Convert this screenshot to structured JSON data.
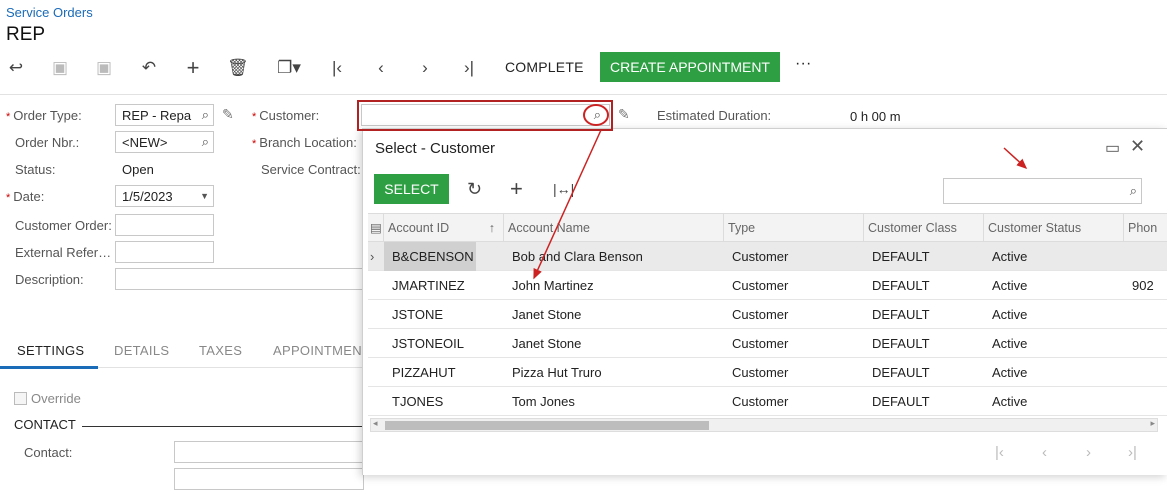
{
  "breadcrumb": "Service Orders",
  "page_title": "REP",
  "toolbar": {
    "complete_label": "COMPLETE",
    "create_appointment_label": "CREATE APPOINTMENT",
    "more_label": "···"
  },
  "form": {
    "order_type": {
      "label": "Order Type:",
      "value": "REP - Repa"
    },
    "order_nbr": {
      "label": "Order Nbr.:",
      "value": "<NEW>"
    },
    "status": {
      "label": "Status:",
      "value": "Open"
    },
    "date": {
      "label": "Date:",
      "value": "1/5/2023"
    },
    "customer_order": {
      "label": "Customer Order:",
      "value": ""
    },
    "external_ref": {
      "label": "External Refer…",
      "value": ""
    },
    "description": {
      "label": "Description:",
      "value": ""
    },
    "customer": {
      "label": "Customer:",
      "value": ""
    },
    "branch_location": {
      "label": "Branch Location:"
    },
    "service_contract": {
      "label": "Service Contract:"
    },
    "estimated_duration": {
      "label": "Estimated Duration:",
      "value": "0 h 00 m"
    }
  },
  "tabs": [
    "SETTINGS",
    "DETAILS",
    "TAXES",
    "APPOINTMENT"
  ],
  "settings": {
    "override_label": "Override",
    "contact_section": "CONTACT",
    "contact_label": "Contact:"
  },
  "dialog": {
    "title": "Select - Customer",
    "select_label": "SELECT",
    "columns": [
      "Account ID",
      "Account Name",
      "Type",
      "Customer Class",
      "Customer Status",
      "Phon"
    ],
    "rows": [
      {
        "account_id": "B&CBENSON",
        "account_name": "Bob and Clara Benson",
        "type": "Customer",
        "class": "DEFAULT",
        "status": "Active",
        "phone": ""
      },
      {
        "account_id": "JMARTINEZ",
        "account_name": "John Martinez",
        "type": "Customer",
        "class": "DEFAULT",
        "status": "Active",
        "phone": "902"
      },
      {
        "account_id": "JSTONE",
        "account_name": "Janet Stone",
        "type": "Customer",
        "class": "DEFAULT",
        "status": "Active",
        "phone": ""
      },
      {
        "account_id": "JSTONEOIL",
        "account_name": "Janet Stone",
        "type": "Customer",
        "class": "DEFAULT",
        "status": "Active",
        "phone": ""
      },
      {
        "account_id": "PIZZAHUT",
        "account_name": "Pizza Hut Truro",
        "type": "Customer",
        "class": "DEFAULT",
        "status": "Active",
        "phone": ""
      },
      {
        "account_id": "TJONES",
        "account_name": "Tom Jones",
        "type": "Customer",
        "class": "DEFAULT",
        "status": "Active",
        "phone": ""
      }
    ]
  },
  "icons": {
    "back": "arrow-back-icon",
    "save_close": "save-close-icon",
    "save": "save-icon",
    "undo": "undo-icon",
    "add": "plus-icon",
    "delete": "trash-icon",
    "copy": "copy-icon",
    "first": "first-page-icon",
    "prev": "chevron-left-icon",
    "next": "chevron-right-icon",
    "last": "last-page-icon"
  },
  "colors": {
    "accent": "#2ea043",
    "link": "#1a6bb8",
    "annotation": "#cc2222"
  }
}
